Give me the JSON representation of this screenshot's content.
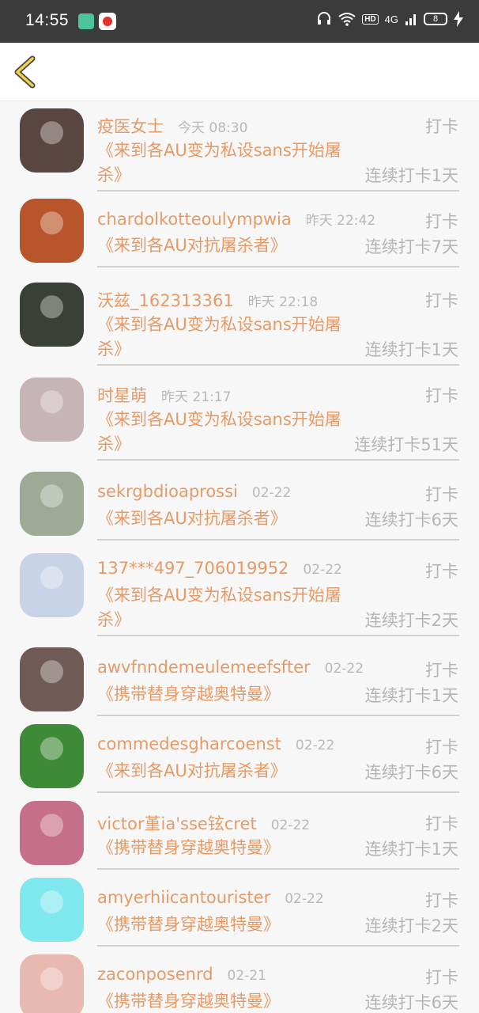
{
  "status_bar": {
    "time": "14:55",
    "network": "4G",
    "hd": "HD",
    "battery": "8"
  },
  "header": {
    "back_icon": "chevron-left-icon"
  },
  "checkins": [
    {
      "name": "疫医女士",
      "time": "今天 08:30",
      "action": "打卡",
      "book": "《来到各AU变为私设sans开始屠杀》",
      "streak": "连续打卡1天",
      "avatar_color": "#5a4640"
    },
    {
      "name": "chardolkotteoulympwia",
      "time": "昨天 22:42",
      "action": "打卡",
      "book": "《来到各AU对抗屠杀者》",
      "streak": "连续打卡7天",
      "avatar_color": "#b8552a"
    },
    {
      "name": "沃兹_162313361",
      "time": "昨天 22:18",
      "action": "打卡",
      "book": "《来到各AU变为私设sans开始屠杀》",
      "streak": "连续打卡1天",
      "avatar_color": "#3a3f38"
    },
    {
      "name": "时星萌",
      "time": "昨天 21:17",
      "action": "打卡",
      "book": "《来到各AU变为私设sans开始屠杀》",
      "streak": "连续打卡51天",
      "avatar_color": "#c7b4b7"
    },
    {
      "name": "sekrgbdioaprossi",
      "time": "02-22",
      "action": "打卡",
      "book": "《来到各AU对抗屠杀者》",
      "streak": "连续打卡6天",
      "avatar_color": "#9eaa96"
    },
    {
      "name": "137***497_706019952",
      "time": "02-22",
      "action": "打卡",
      "book": "《来到各AU变为私设sans开始屠杀》",
      "streak": "连续打卡2天",
      "avatar_color": "#c9d3e8"
    },
    {
      "name": "awvfnndemeulemeefsfter",
      "time": "02-22",
      "action": "打卡",
      "book": "《携带替身穿越奥特曼》",
      "streak": "连续打卡1天",
      "avatar_color": "#6f5a55"
    },
    {
      "name": "commedesgharcoenst",
      "time": "02-22",
      "action": "打卡",
      "book": "《来到各AU对抗屠杀者》",
      "streak": "连续打卡6天",
      "avatar_color": "#3f8a37"
    },
    {
      "name": "victor堇ia'sse铉cret",
      "time": "02-22",
      "action": "打卡",
      "book": "《携带替身穿越奥特曼》",
      "streak": "连续打卡1天",
      "avatar_color": "#c66f8a"
    },
    {
      "name": "amyerhiicantourister",
      "time": "02-22",
      "action": "打卡",
      "book": "《携带替身穿越奥特曼》",
      "streak": "连续打卡2天",
      "avatar_color": "#7fe8ee"
    },
    {
      "name": "zaconposenrd",
      "time": "02-21",
      "action": "打卡",
      "book": "《携带替身穿越奥特曼》",
      "streak": "连续打卡6天",
      "avatar_color": "#e8b9b0"
    }
  ]
}
